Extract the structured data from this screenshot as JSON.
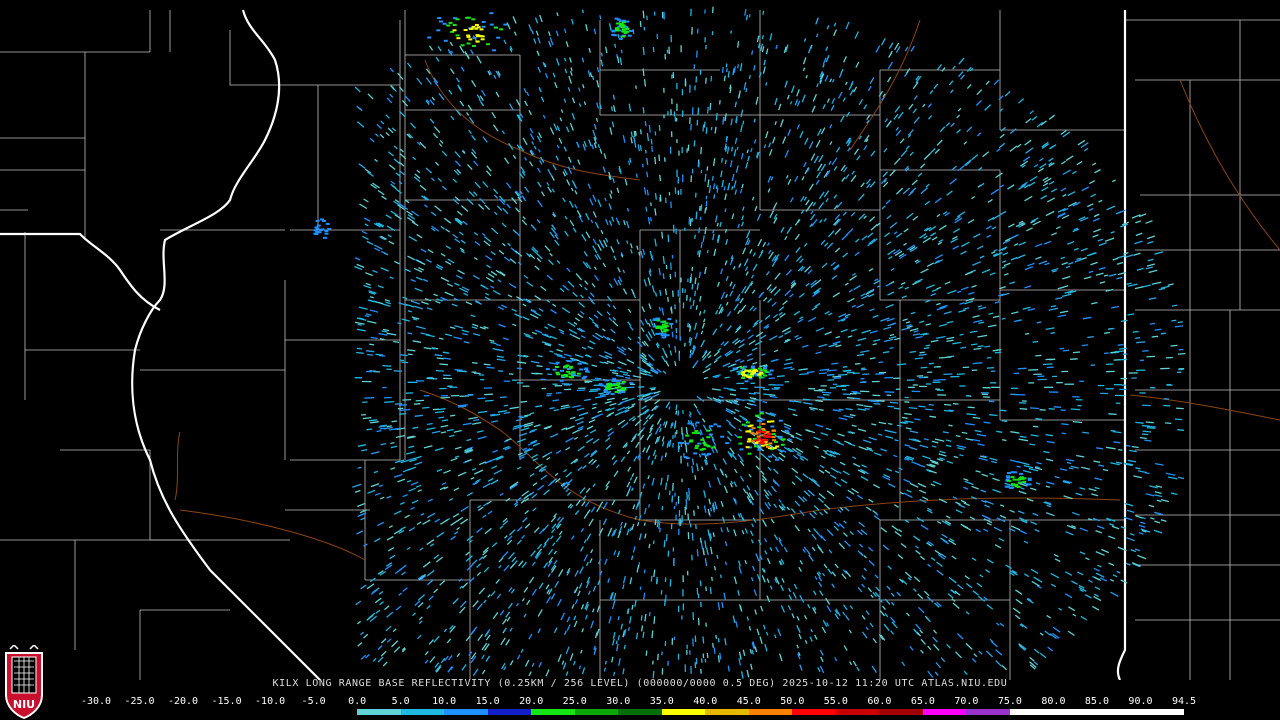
{
  "product": {
    "caption": "KILX LONG RANGE BASE REFLECTIVITY (0.25KM / 256 LEVEL) (000000/0000 0.5 DEG) 2025-10-12 11:20 UTC  ATLAS.NIU.EDU"
  },
  "color_scale": {
    "ticks": [
      "-30.0",
      "-25.0",
      "-20.0",
      "-15.0",
      "-10.0",
      "-5.0",
      "0.0",
      "5.0",
      "10.0",
      "15.0",
      "20.0",
      "25.0",
      "30.0",
      "35.0",
      "40.0",
      "45.0",
      "50.0",
      "55.0",
      "60.0",
      "65.0",
      "70.0",
      "75.0",
      "80.0",
      "85.0",
      "90.0",
      "94.5"
    ],
    "colors": [
      "#000000",
      "#000000",
      "#000000",
      "#000000",
      "#000000",
      "#000000",
      "#5fd3d3",
      "#1fb8e0",
      "#1e90ff",
      "#1020c8",
      "#14e614",
      "#0aa60a",
      "#056e05",
      "#ffff00",
      "#e6b800",
      "#ff8000",
      "#ff0000",
      "#c80000",
      "#a00000",
      "#ff00ff",
      "#9932cc",
      "#ffffff",
      "#ffffff",
      "#ffffff",
      "#ffffff"
    ]
  },
  "map": {
    "radar_site": "KILX",
    "colors": {
      "state_border": "#ffffff",
      "county_border": "#bfbfbf",
      "river": "#8b4513"
    }
  },
  "logo": {
    "text": "NIU",
    "colors": {
      "shield": "#c8102e",
      "outline": "#ffffff"
    }
  }
}
